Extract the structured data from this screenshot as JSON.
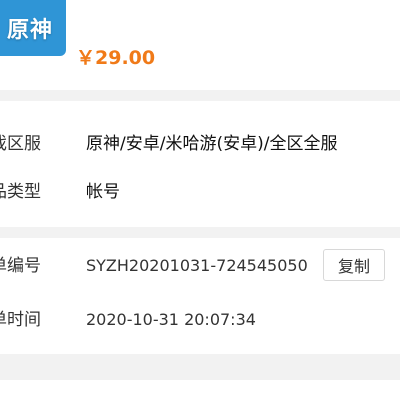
{
  "product": {
    "thumbnail_text": "原神",
    "title": "",
    "price": "￥29.00"
  },
  "info": {
    "region_label": "戏区服",
    "region_value": "原神/安卓/米哈游(安卓)/全区全服",
    "type_label": "品类型",
    "type_value": "帐号"
  },
  "order": {
    "number_label": "单编号",
    "number_value": "SYZH20201031-724545050",
    "copy_label": "复制",
    "time_label": "单时间",
    "time_value": "2020-10-31 20:07:34"
  },
  "colors": {
    "price": "#f07a18",
    "thumbnail_bg": "#2f95d6",
    "page_bg": "#f2f2f2"
  }
}
